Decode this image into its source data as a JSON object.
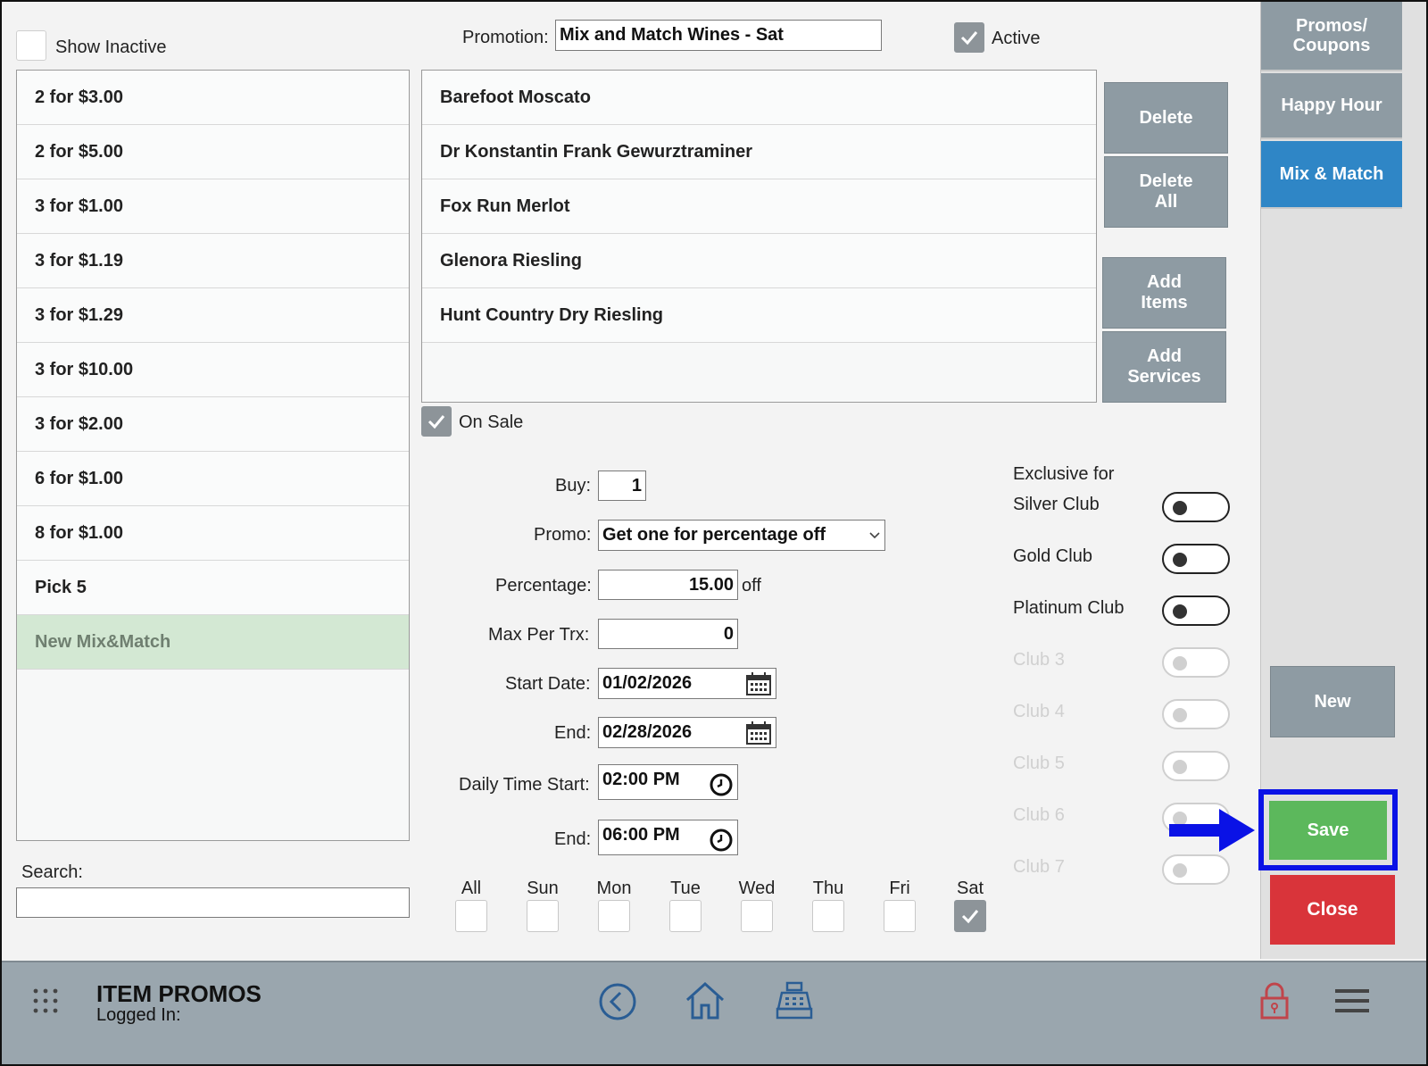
{
  "left": {
    "show_inactive_label": "Show Inactive",
    "items": [
      "2 for $3.00",
      "2 for $5.00",
      "3 for $1.00",
      "3 for $1.19",
      "3 for $1.29",
      "3 for $10.00",
      "3 for $2.00",
      "6 for $1.00",
      "8 for $1.00",
      "Pick 5",
      "New Mix&Match"
    ],
    "selected_index": 10,
    "search_label": "Search:",
    "search_value": ""
  },
  "promotion": {
    "label": "Promotion:",
    "value": "Mix and Match Wines - Sat",
    "active_label": "Active",
    "active_checked": true
  },
  "items": {
    "list": [
      "Barefoot Moscato",
      "Dr Konstantin Frank Gewurztraminer",
      "Fox Run Merlot",
      "Glenora Riesling",
      "Hunt Country Dry Riesling"
    ],
    "buttons": {
      "delete": "Delete",
      "delete_all": "Delete All",
      "add_items": "Add Items",
      "add_services": "Add Services"
    },
    "on_sale_label": "On Sale",
    "on_sale_checked": true
  },
  "form": {
    "buy_label": "Buy:",
    "buy_value": "1",
    "promo_label": "Promo:",
    "promo_value": "Get one for percentage off",
    "percentage_label": "Percentage:",
    "percentage_value": "15.00",
    "percentage_suffix": "off",
    "max_label": "Max Per Trx:",
    "max_value": "0",
    "start_date_label": "Start Date:",
    "start_date_value": "01/02/2026",
    "end_date_label": "End:",
    "end_date_value": "02/28/2026",
    "time_start_label": "Daily Time Start:",
    "time_start_value": "02:00 PM",
    "time_end_label": "End:",
    "time_end_value": "06:00 PM"
  },
  "days": {
    "labels": [
      "All",
      "Sun",
      "Mon",
      "Tue",
      "Wed",
      "Thu",
      "Fri",
      "Sat"
    ],
    "checked": [
      false,
      false,
      false,
      false,
      false,
      false,
      false,
      true
    ]
  },
  "clubs": {
    "title": "Exclusive for",
    "list": [
      {
        "name": "Silver Club",
        "enabled": true
      },
      {
        "name": "Gold Club",
        "enabled": true
      },
      {
        "name": "Platinum Club",
        "enabled": true
      },
      {
        "name": "Club 3",
        "enabled": false
      },
      {
        "name": "Club 4",
        "enabled": false
      },
      {
        "name": "Club 5",
        "enabled": false
      },
      {
        "name": "Club 6",
        "enabled": false
      },
      {
        "name": "Club 7",
        "enabled": false
      }
    ]
  },
  "nav": {
    "promos_coupons": "Promos/ Coupons",
    "happy_hour": "Happy Hour",
    "mix_match": "Mix & Match",
    "new": "New",
    "save": "Save",
    "close": "Close"
  },
  "bottom": {
    "title": "ITEM PROMOS",
    "logged_in": "Logged In:"
  },
  "colors": {
    "tab_gray": "#8e9ba3",
    "tab_active": "#2f86c6",
    "save_green": "#5cb85c",
    "close_red": "#d9343a",
    "highlight_blue": "#0a12e6"
  }
}
